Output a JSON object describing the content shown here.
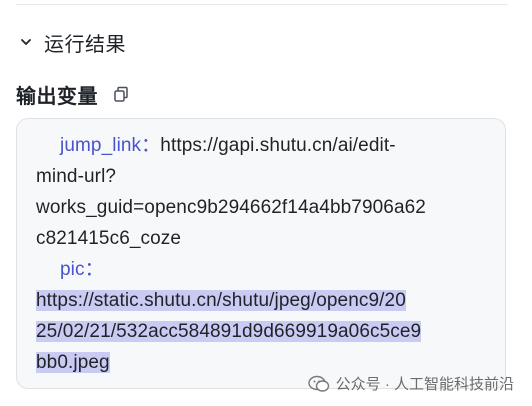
{
  "section": {
    "title": "运行结果"
  },
  "output": {
    "label": "输出变量",
    "jump_link_key": "jump_link",
    "jump_link_sep": "：",
    "jump_link_line1": "https://gapi.shutu.cn/ai/edit-",
    "jump_link_line2": "mind-url?",
    "jump_link_line3": "works_guid=openc9b294662f14a4bb7906a62",
    "jump_link_line4": "c821415c6_coze",
    "pic_key": "pic",
    "pic_sep": "：",
    "pic_line1": "https://static.shutu.cn/shutu/jpeg/openc9/20",
    "pic_line2": "25/02/21/532acc584891d9d669919a06c5ce9",
    "pic_line3": "bb0.jpeg"
  },
  "watermark": {
    "text": "公众号 · 人工智能科技前沿"
  },
  "icons": {
    "chevron": "chevron-down-icon",
    "copy": "copy-icon",
    "watermark": "wechat-icon"
  },
  "colors": {
    "key": "#4a53c9",
    "selection": "#c9cbf2",
    "box_bg": "#f7f8fa"
  }
}
